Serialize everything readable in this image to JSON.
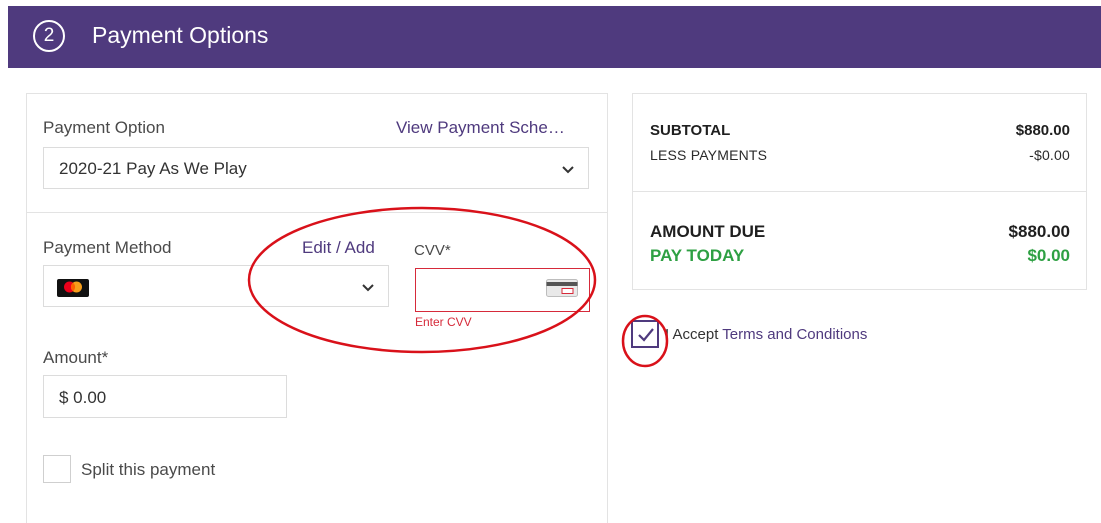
{
  "header": {
    "step_number": "2",
    "title": "Payment Options",
    "bg_color": "#4f3a7e"
  },
  "payment_option": {
    "label": "Payment Option",
    "view_link": "View Payment Sche…",
    "selected": "2020-21 Pay As We Play"
  },
  "payment_method": {
    "label": "Payment Method",
    "edit_link": "Edit / Add",
    "card_brand_icon": "mastercard-icon"
  },
  "cvv": {
    "label": "CVV*",
    "value": "",
    "error": "Enter CVV",
    "error_color": "#d62a3a"
  },
  "amount": {
    "label": "Amount*",
    "value": "$ 0.00"
  },
  "split": {
    "label": "Split this payment",
    "checked": false
  },
  "summary": {
    "subtotal_label": "SUBTOTAL",
    "subtotal_value": "$880.00",
    "less_payments_label": "LESS PAYMENTS",
    "less_payments_value": "-$0.00",
    "amount_due_label": "AMOUNT DUE",
    "amount_due_value": "$880.00",
    "pay_today_label": "PAY TODAY",
    "pay_today_value": "$0.00",
    "pay_today_color": "#2ea043"
  },
  "terms": {
    "prefix": "I Accept ",
    "link": "Terms and Conditions",
    "checked": true
  }
}
